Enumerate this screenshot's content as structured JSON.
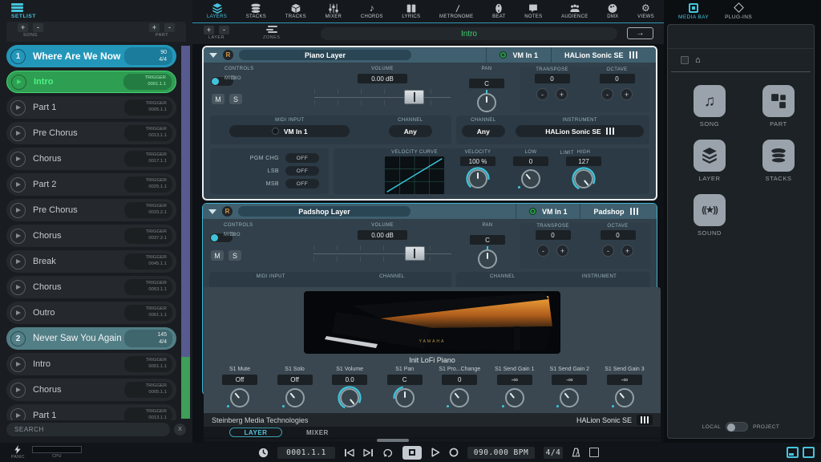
{
  "toolbar": {
    "tabs": [
      {
        "label": "LAYERS",
        "active": true
      },
      {
        "label": "STACKS"
      },
      {
        "label": "TRACKS"
      },
      {
        "label": "MIXER"
      },
      {
        "label": "CHORDS"
      },
      {
        "label": "LYRICS"
      },
      {
        "label": "METRONOME"
      },
      {
        "label": "BEAT"
      },
      {
        "label": "NOTES"
      },
      {
        "label": "AUDIENCE"
      },
      {
        "label": "DMX"
      },
      {
        "label": "VIEWS"
      }
    ]
  },
  "icons": {
    "plus": "+",
    "minus": "-",
    "gear": "⚙",
    "eighth_note": "♪",
    "song_note": "♫",
    "home": "⌂",
    "sound_star": "((★))"
  },
  "setlist": {
    "title": "SETLIST",
    "song_label": "SONG",
    "part_label": "PART",
    "items": [
      {
        "kind": "song",
        "state": "current",
        "num": "1",
        "name": "Where Are We Now",
        "line1": "90",
        "line2": "4/4"
      },
      {
        "kind": "part",
        "state": "active",
        "name": "Intro",
        "line1": "TRIGGER",
        "line2": "0001.1.1"
      },
      {
        "kind": "part",
        "state": "normal",
        "name": "Part 1",
        "line1": "TRIGGER",
        "line2": "0005.1.1"
      },
      {
        "kind": "part",
        "state": "normal",
        "name": "Pre Chorus",
        "line1": "TRIGGER",
        "line2": "0013.1.1"
      },
      {
        "kind": "part",
        "state": "normal",
        "name": "Chorus",
        "line1": "TRIGGER",
        "line2": "0017.1.1"
      },
      {
        "kind": "part",
        "state": "normal",
        "name": "Part 2",
        "line1": "TRIGGER",
        "line2": "0025.1.1"
      },
      {
        "kind": "part",
        "state": "normal",
        "name": "Pre Chorus",
        "line1": "TRIGGER",
        "line2": "0033.2.1"
      },
      {
        "kind": "part",
        "state": "normal",
        "name": "Chorus",
        "line1": "TRIGGER",
        "line2": "0037.2.1"
      },
      {
        "kind": "part",
        "state": "normal",
        "name": "Break",
        "line1": "TRIGGER",
        "line2": "0045.1.1"
      },
      {
        "kind": "part",
        "state": "normal",
        "name": "Chorus",
        "line1": "TRIGGER",
        "line2": "0053.1.1"
      },
      {
        "kind": "part",
        "state": "normal",
        "name": "Outro",
        "line1": "TRIGGER",
        "line2": "0061.1.1"
      },
      {
        "kind": "song",
        "state": "normal",
        "num": "2",
        "name": "Never Saw You Again",
        "line1": "145",
        "line2": "4/4"
      },
      {
        "kind": "part",
        "state": "normal",
        "name": "Intro",
        "line1": "TRIGGER",
        "line2": "0001.1.1"
      },
      {
        "kind": "part",
        "state": "normal",
        "name": "Chorus",
        "line1": "TRIGGER",
        "line2": "0005.1.1"
      },
      {
        "kind": "part",
        "state": "normal",
        "name": "Part 1",
        "line1": "TRIGGER",
        "line2": "0013.1.1"
      }
    ],
    "search_placeholder": "SEARCH",
    "clear_label": "X"
  },
  "sub_toolbar": {
    "layer_label": "LAYER",
    "zones_label": "ZONES",
    "current_part": "Intro",
    "arrow": "→"
  },
  "layers": [
    {
      "name": "Piano Layer",
      "record": "R",
      "input": "VM In 1",
      "instrument": "HALion Sonic SE",
      "controls_label": "CONTROLS",
      "audio_label": "AUDIO",
      "midi_label": "MIDI",
      "mute": "M",
      "solo": "S",
      "volume_label": "VOLUME",
      "volume": "0.00 dB",
      "pan_label": "PAN",
      "pan": "C",
      "transpose_label": "TRANSPOSE",
      "transpose": "0",
      "octave_label": "OCTAVE",
      "octave": "0",
      "minus": "-",
      "plus": "+",
      "midi_input_label": "MIDI INPUT",
      "midi_input": "VM In 1",
      "channel_label": "CHANNEL",
      "channel": "Any",
      "inst_channel_label": "CHANNEL",
      "inst_channel": "Any",
      "instrument_label": "INSTRUMENT",
      "pgm_label": "PGM CHG",
      "pgm": "OFF",
      "lsb_label": "LSB",
      "lsb": "OFF",
      "msb_label": "MSB",
      "msb": "OFF",
      "curve_label": "VELOCITY CURVE",
      "velocity_label": "VELOCITY",
      "velocity": "100 %",
      "low_label": "LOW",
      "low": "0",
      "limit_label": "LIMIT",
      "high_label": "HIGH",
      "high": "127"
    },
    {
      "name": "Padshop Layer",
      "record": "R",
      "input": "VM In 1",
      "instrument": "Padshop",
      "controls_label": "CONTROLS",
      "audio_label": "AUDIO",
      "midi_label": "MIDI",
      "mute": "M",
      "solo": "S",
      "volume_label": "VOLUME",
      "volume": "0.00 dB",
      "pan_label": "PAN",
      "pan": "C",
      "transpose_label": "TRANSPOSE",
      "transpose": "0",
      "octave_label": "OCTAVE",
      "octave": "0",
      "minus": "-",
      "plus": "+",
      "midi_input_label": "MIDI INPUT",
      "channel_label": "CHANNEL",
      "inst_channel_label": "CHANNEL",
      "instrument_label": "INSTRUMENT"
    }
  ],
  "instrument_panel": {
    "preset": "Init LoFi Piano",
    "image_brand": "YAMAHA",
    "params": [
      {
        "label": "S1 Mute",
        "value": "Off",
        "knob": "dot"
      },
      {
        "label": "S1 Solo",
        "value": "Off",
        "knob": "dot"
      },
      {
        "label": "S1 Volume",
        "value": "0.0",
        "knob": "full"
      },
      {
        "label": "S1 Pan",
        "value": "C",
        "knob": "left"
      },
      {
        "label": "S1 Pro...Change",
        "value": "0",
        "knob": "dot"
      },
      {
        "label": "S1 Send Gain 1",
        "value": "-∞",
        "knob": "dot"
      },
      {
        "label": "S1 Send Gain 2",
        "value": "-∞",
        "knob": "dot"
      },
      {
        "label": "S1 Send Gain 3",
        "value": "-∞",
        "knob": "dot"
      }
    ],
    "vendor": "Steinberg Media Technologies",
    "plugin": "HALion Sonic SE",
    "tabs": [
      {
        "label": "LAYER",
        "active": true
      },
      {
        "label": "MIXER"
      }
    ]
  },
  "transport": {
    "time": "0001.1.1",
    "tempo": "090.000 BPM",
    "signature": "4/4"
  },
  "media_bay": {
    "tabs": [
      {
        "label": "MEDIA BAY",
        "active": true
      },
      {
        "label": "PLUG-INS"
      }
    ],
    "tiles": [
      {
        "label": "SONG"
      },
      {
        "label": "PART"
      },
      {
        "label": "LAYER"
      },
      {
        "label": "STACKS"
      },
      {
        "label": "SOUND"
      }
    ],
    "local_label": "LOCAL",
    "project_label": "PROJECT"
  },
  "status": {
    "panic": "PANIC",
    "cpu": "CPU"
  },
  "colors": {
    "accent": "#46c4dc",
    "song_current": "#2397ba",
    "part_active": "#2e9e52",
    "song_inactive": "#527e86",
    "strip_purple": "#575a8e",
    "strip_green": "#3f9e58"
  }
}
